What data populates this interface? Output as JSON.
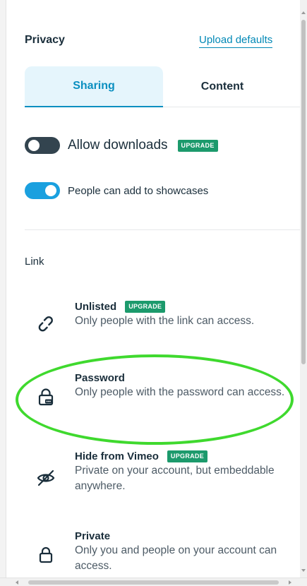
{
  "header": {
    "title": "Privacy",
    "upload_defaults_link": "Upload defaults"
  },
  "tabs": [
    {
      "label": "Sharing",
      "active": true
    },
    {
      "label": "Content",
      "active": false
    }
  ],
  "toggles": [
    {
      "label": "Allow downloads",
      "state": "off",
      "badge": "UPGRADE"
    },
    {
      "label": "People can add to showcases",
      "state": "on"
    }
  ],
  "link_section": {
    "label": "Link",
    "options": [
      {
        "title": "Unlisted",
        "badge": "UPGRADE",
        "description": "Only people with the link can access.",
        "icon": "link-icon"
      },
      {
        "title": "Password",
        "description": "Only people with the password can access.",
        "icon": "password-lock-icon",
        "highlighted": true
      },
      {
        "title": "Hide from Vimeo",
        "badge": "UPGRADE",
        "description": "Private on your account, but embeddable anywhere.",
        "icon": "eye-off-icon"
      },
      {
        "title": "Private",
        "description": "Only you and people on your account can access.",
        "icon": "lock-icon"
      }
    ]
  },
  "colors": {
    "accent": "#0a8fc0",
    "tab_active_bg": "#e5f5fc",
    "badge": "#1c9a6c",
    "toggle_on": "#1aa0df",
    "toggle_off": "#33444f",
    "highlight": "#3fd92e",
    "text": "#1a2e3b"
  }
}
